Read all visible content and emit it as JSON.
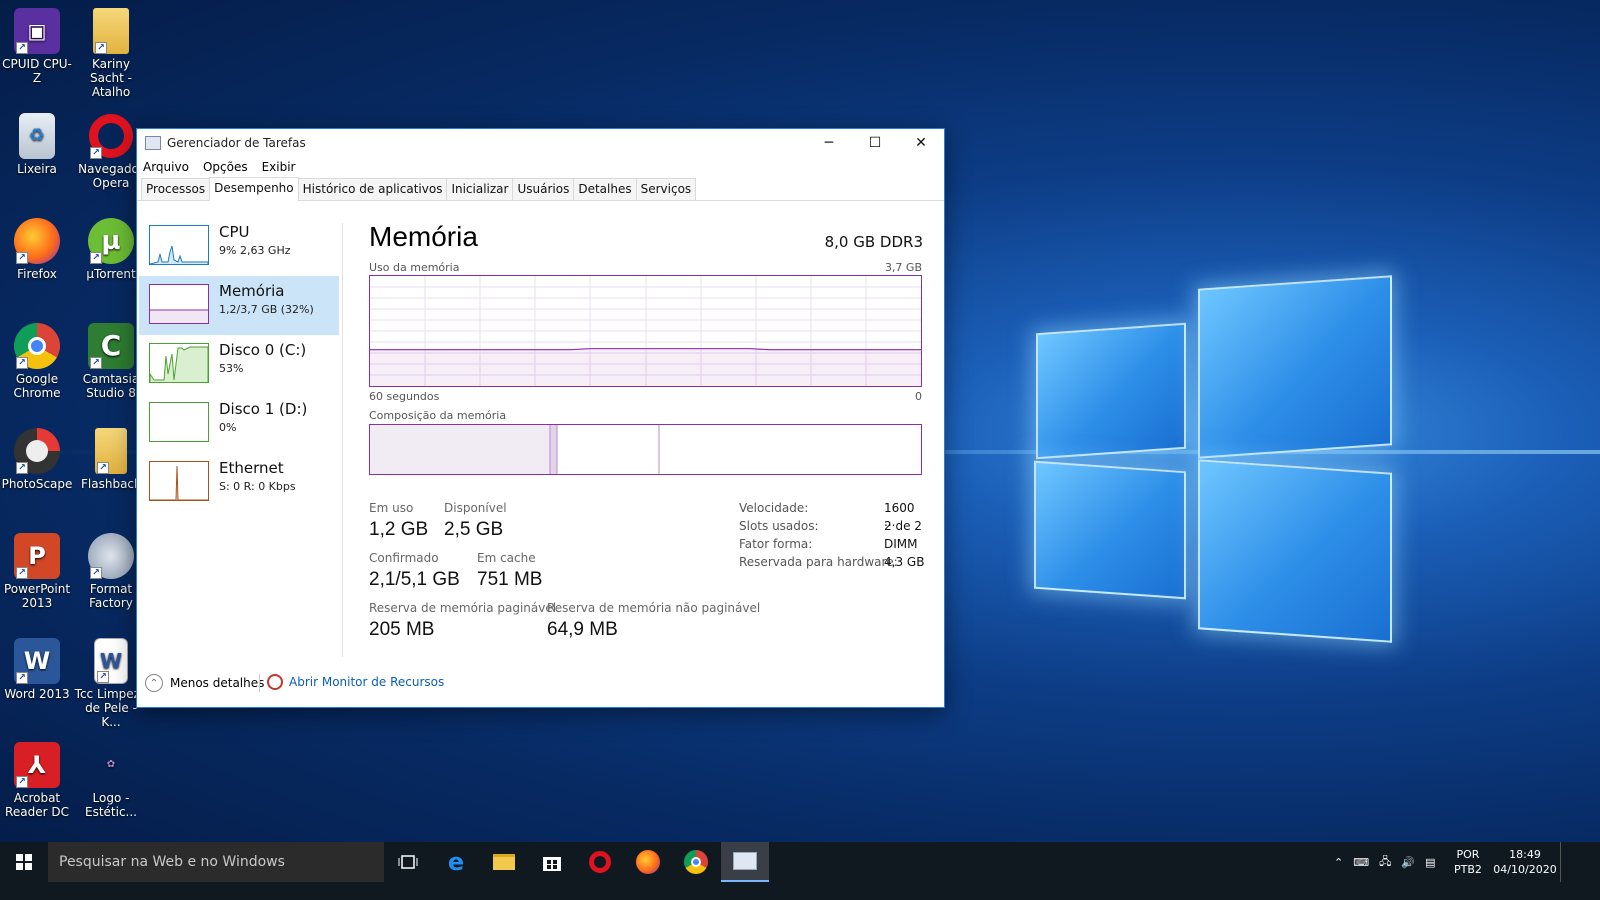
{
  "desktop": {
    "icons": [
      {
        "label": "CPUID CPU-Z",
        "icon": "cpuz-icon"
      },
      {
        "label": "Kariny Sacht - Atalho",
        "icon": "folder-icon"
      },
      {
        "label": "Lixeira",
        "icon": "recycle-bin-icon"
      },
      {
        "label": "Navegador Opera",
        "icon": "opera-icon"
      },
      {
        "label": "Firefox",
        "icon": "firefox-icon"
      },
      {
        "label": "µTorrent",
        "icon": "utorrent-icon"
      },
      {
        "label": "Google Chrome",
        "icon": "chrome-icon"
      },
      {
        "label": "Camtasia Studio 8",
        "icon": "camtasia-icon"
      },
      {
        "label": "PhotoScape",
        "icon": "photoscape-icon"
      },
      {
        "label": "Flashback",
        "icon": "folder-icon"
      },
      {
        "label": "PowerPoint 2013",
        "icon": "powerpoint-icon"
      },
      {
        "label": "Format Factory",
        "icon": "format-factory-icon"
      },
      {
        "label": "Word 2013",
        "icon": "word-icon"
      },
      {
        "label": "Tcc Limpeza de Pele - K...",
        "icon": "word-doc-icon"
      },
      {
        "label": "Acrobat Reader DC",
        "icon": "acrobat-icon"
      },
      {
        "label": "Logo - Estétic...",
        "icon": "logo-image-icon"
      }
    ]
  },
  "taskmanager": {
    "title": "Gerenciador de Tarefas",
    "menu": [
      "Arquivo",
      "Opções",
      "Exibir"
    ],
    "tabs": [
      "Processos",
      "Desempenho",
      "Histórico de aplicativos",
      "Inicializar",
      "Usuários",
      "Detalhes",
      "Serviços"
    ],
    "active_tab": "Desempenho",
    "sidebar": [
      {
        "name": "CPU",
        "sub": "9% 2,63 GHz",
        "color": "#1a7dc4"
      },
      {
        "name": "Memória",
        "sub": "1,2/3,7 GB (32%)",
        "color": "#8b2fa8"
      },
      {
        "name": "Disco 0 (C:)",
        "sub": "53%",
        "color": "#4da033"
      },
      {
        "name": "Disco 1 (D:)",
        "sub": "0%",
        "color": "#4da033"
      },
      {
        "name": "Ethernet",
        "sub": "S: 0 R: 0 Kbps",
        "color": "#a7531d"
      }
    ],
    "main": {
      "heading": "Memória",
      "spec": "8,0 GB DDR3",
      "usage_label": "Uso da memória",
      "usage_max": "3,7 GB",
      "time_left": "60 segundos",
      "time_right": "0",
      "usage_fraction": 0.33,
      "composition_label": "Composição da memória",
      "stats": {
        "em_uso_label": "Em uso",
        "em_uso": "1,2 GB",
        "disponivel_label": "Disponível",
        "disponivel": "2,5 GB",
        "confirmado_label": "Confirmado",
        "confirmado": "2,1/5,1 GB",
        "cache_label": "Em cache",
        "cache": "751 MB",
        "paginavel_label": "Reserva de memória paginável",
        "paginavel": "205 MB",
        "nao_paginavel_label": "Reserva de memória não paginável",
        "nao_paginavel": "64,9 MB"
      },
      "details": [
        {
          "k": "Velocidade:",
          "v": "1600 ..."
        },
        {
          "k": "Slots usados:",
          "v": "2 de 2"
        },
        {
          "k": "Fator forma:",
          "v": "DIMM"
        },
        {
          "k": "Reservada para hardware:",
          "v": "4,3 GB"
        }
      ]
    },
    "footer": {
      "less": "Menos detalhes",
      "resource_monitor": "Abrir Monitor de Recursos"
    }
  },
  "taskbar": {
    "search_placeholder": "Pesquisar na Web e no Windows",
    "lang": "POR",
    "layout": "PTB2",
    "time": "18:49",
    "date": "04/10/2020"
  }
}
